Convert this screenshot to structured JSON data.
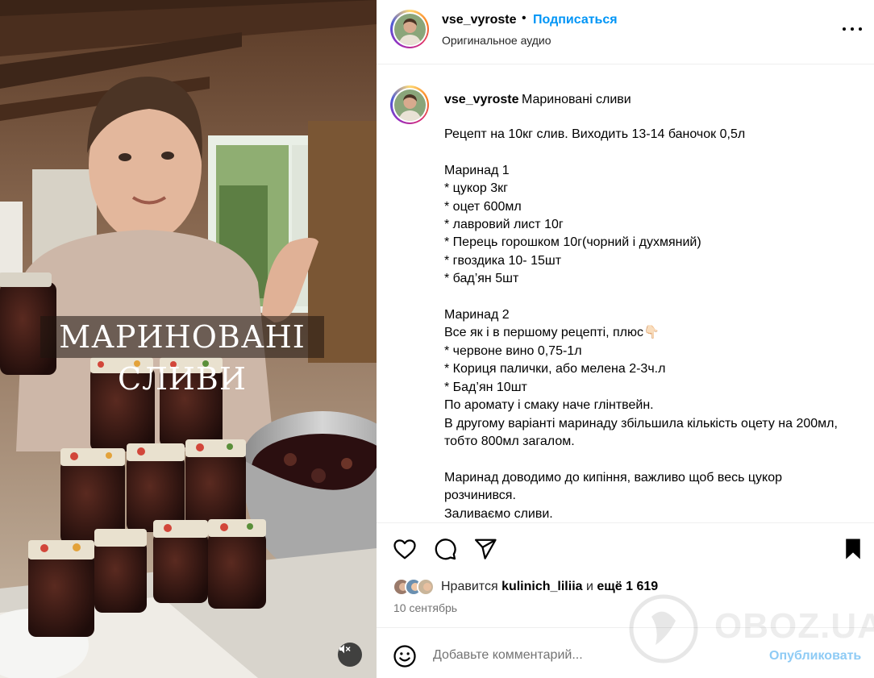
{
  "post": {
    "username": "vse_vyroste",
    "follow_label": "Подписаться",
    "separator": "•",
    "audio_label": "Оригинальное аудио",
    "video_overlay_text": "МАРИНОВАНІ СЛИВИ",
    "caption_title": "Мариновані сливи",
    "caption_body": "Рецепт на 10кг слив. Виходить 13-14 баночок 0,5л\n\nМаринад 1\n* цукор 3кг\n* оцет 600мл\n* лавровий лист 10г\n* Перець горошком 10г(чорний і духмяний)\n* гвоздика 10- 15шт\n* бад’ян 5шт\n\nМаринад 2\nВсе як і в першому рецепті, плюс👇🏻\n* червоне вино 0,75-1л\n* Кориця палички, або мелена 2-3ч.л\n* Бад’ян 10шт\nПо аромату і смаку наче глінтвейн.\nВ другому варіанті маринаду збільшила кількість оцету на 200мл, тобто 800мл загалом.\n\nМаринад доводимо до кипіння, важливо щоб весь цукор розчинився.\nЗаливаємо сливи."
  },
  "likes": {
    "prefix": "Нравится",
    "user": "kulinich_liliia",
    "middle": "и",
    "others": "ещё 1 619"
  },
  "date": "10 сентябрь",
  "comment": {
    "placeholder": "Добавьте комментарий...",
    "publish_label": "Опубликовать"
  },
  "watermark": "OBOZ.UA",
  "icons": {
    "more": "more-horizontal-icon",
    "like": "heart-icon",
    "comment": "comment-bubble-icon",
    "share": "paper-plane-icon",
    "save": "bookmark-icon",
    "emoji": "emoji-smile-icon",
    "mute": "speaker-muted-icon"
  },
  "colors": {
    "accent": "#0095f6",
    "publish_disabled": "#8ecbf5",
    "secondary_text": "#737373",
    "divider": "#efefef"
  }
}
